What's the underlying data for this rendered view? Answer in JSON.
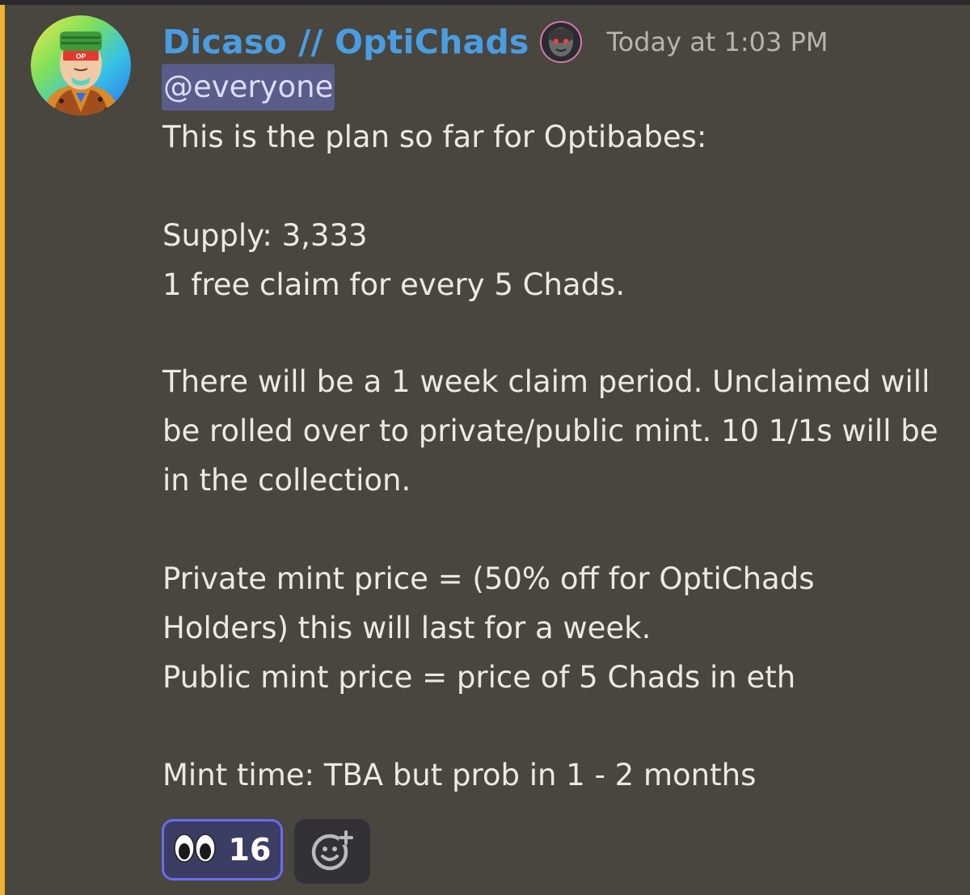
{
  "message": {
    "author": "Dicaso // OptiChads",
    "timestamp": "Today at 1:03 PM",
    "mention": "@everyone",
    "lines": [
      "This is the plan so far for Optibabes:",
      "Supply: 3,333",
      "1 free claim for every 5 Chads.",
      "There will be a 1 week claim period. Unclaimed will",
      "be rolled over to private/public mint. 10 1/1s will be",
      "in the collection.",
      "Private mint price = (50% off for OptiChads",
      "Holders) this will last for a week.",
      "Public mint price = price of 5 Chads in eth",
      "Mint time: TBA but prob in 1 - 2 months"
    ],
    "avatar_text": "OP"
  },
  "reactions": [
    {
      "emoji": "eyes-emoji",
      "count": "16"
    }
  ],
  "add_reaction_icon": "add-reaction-icon",
  "colors": {
    "background": "#49453f",
    "mention_bar": "#f0b232",
    "username": "#4a9de0",
    "mention_bg": "#5a5c8a",
    "reaction_border": "#6a6cf2"
  }
}
